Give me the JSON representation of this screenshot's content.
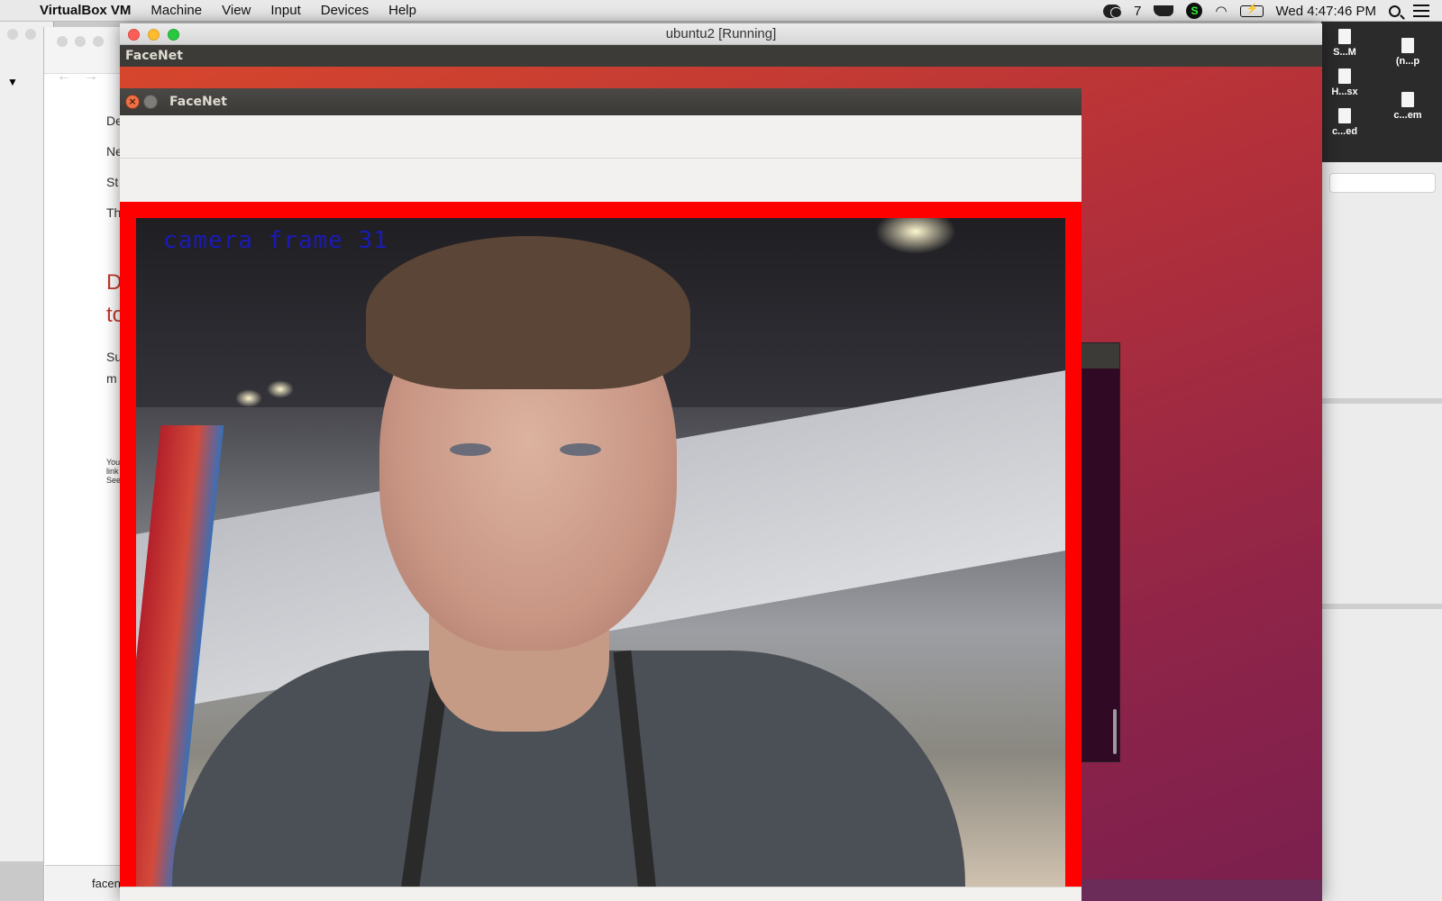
{
  "menubar": {
    "app_name": "VirtualBox VM",
    "items": [
      "Machine",
      "View",
      "Input",
      "Devices",
      "Help"
    ],
    "wechat_count": "7",
    "clock": "Wed 4:47:46 PM"
  },
  "background_left": {
    "lines": [
      "De",
      "Ne",
      "St",
      "Th"
    ],
    "heading_lines": [
      "D",
      "to"
    ],
    "body_lines": [
      "Su",
      "m"
    ],
    "small_lines": [
      "You",
      "link",
      "See"
    ],
    "file_label": "facen"
  },
  "desktop_icons": [
    {
      "label": "S...M"
    },
    {
      "label": "(n...p"
    },
    {
      "label": "H...sx"
    },
    {
      "label": "c...em"
    },
    {
      "label": "c...ed"
    }
  ],
  "vm_window": {
    "title": "ubuntu2 [Running]"
  },
  "ubuntu": {
    "topbar_title": "FaceNet"
  },
  "facenet_window": {
    "title": "FaceNet",
    "overlay_text": "camera frame 31",
    "face_box_color": "#ff0000",
    "overlay_text_color": "#1a1ab8"
  }
}
